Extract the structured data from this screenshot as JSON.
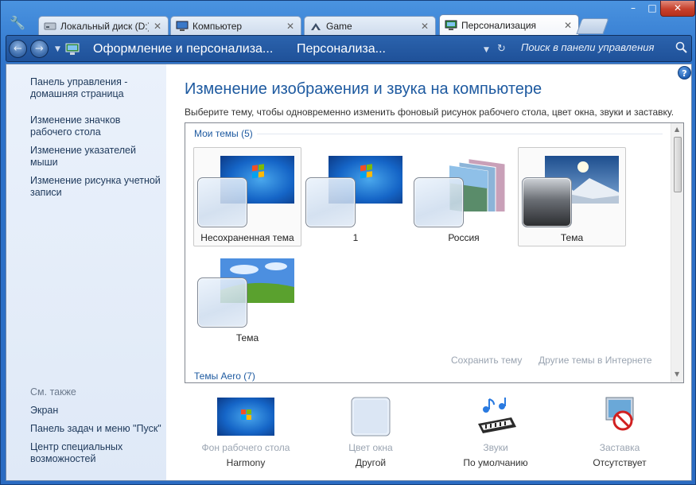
{
  "tabs": [
    {
      "label": "Локальный диск (D:)",
      "icon": "drive-icon"
    },
    {
      "label": "Компьютер",
      "icon": "computer-icon"
    },
    {
      "label": "Game",
      "icon": "folder-game-icon"
    },
    {
      "label": "Персонализация",
      "icon": "personalization-icon",
      "active": true
    }
  ],
  "window_controls": {
    "minimize": "–",
    "maximize": "□",
    "close": "✕"
  },
  "navbar": {
    "breadcrumb": [
      "Оформление и персонализа...",
      "Персонализа..."
    ],
    "search_placeholder": "Поиск в панели управления"
  },
  "sidebar": {
    "links": [
      "Панель управления - домашняя страница",
      "Изменение значков рабочего стола",
      "Изменение указателей мыши",
      "Изменение рисунка учетной записи"
    ],
    "see_also_label": "См. также",
    "see_also": [
      "Экран",
      "Панель задач и меню \"Пуск\"",
      "Центр специальных возможностей"
    ]
  },
  "main": {
    "title": "Изменение изображения и звука на компьютере",
    "subtitle": "Выберите тему, чтобы одновременно изменить фоновый рисунок рабочего стола, цвет окна, звуки и заставку.",
    "my_themes_header": "Мои темы (5)",
    "aero_themes_header": "Темы Aero (7)",
    "themes": [
      {
        "label": "Несохраненная тема",
        "wallpaper": "win7-blue"
      },
      {
        "label": "1",
        "wallpaper": "win7-blue"
      },
      {
        "label": "Россия",
        "wallpaper": "russia-slides"
      },
      {
        "label": "Тема",
        "wallpaper": "snow-sun"
      },
      {
        "label": "Тема",
        "wallpaper": "xp-bliss"
      }
    ],
    "save_theme_link": "Сохранить тему",
    "more_themes_link": "Другие темы в Интернете"
  },
  "settings": [
    {
      "name": "Фон рабочего стола",
      "value": "Harmony",
      "icon": "desktop-background-icon"
    },
    {
      "name": "Цвет окна",
      "value": "Другой",
      "icon": "window-color-icon"
    },
    {
      "name": "Звуки",
      "value": "По умолчанию",
      "icon": "sounds-icon"
    },
    {
      "name": "Заставка",
      "value": "Отсутствует",
      "icon": "screensaver-icon"
    }
  ],
  "colors": {
    "accent": "#1e5aa0",
    "link": "#1e395b",
    "disabled": "#9aa4b1"
  }
}
